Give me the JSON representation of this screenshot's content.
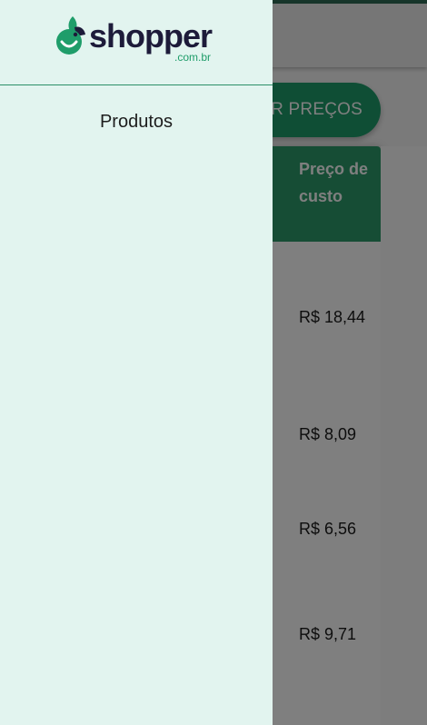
{
  "drawer": {
    "logo": {
      "name": "shopper",
      "domain": ".com.br"
    },
    "nav_items": [
      {
        "label": "Produtos"
      }
    ]
  },
  "background": {
    "update_button": {
      "label": "ATUALIZAR PREÇOS",
      "visible_label": "AR PREÇOS"
    },
    "table": {
      "column_header": "Preço de custo",
      "rows": [
        "R$ 18,44",
        "R$ 8,09",
        "R$ 6,56",
        "R$ 9,71"
      ]
    }
  },
  "colors": {
    "brand_green": "#1f9d6a",
    "drawer_bg": "#e2f4ef",
    "table_header": "#2c9b6b",
    "logo_dark": "#1d1b3a"
  }
}
